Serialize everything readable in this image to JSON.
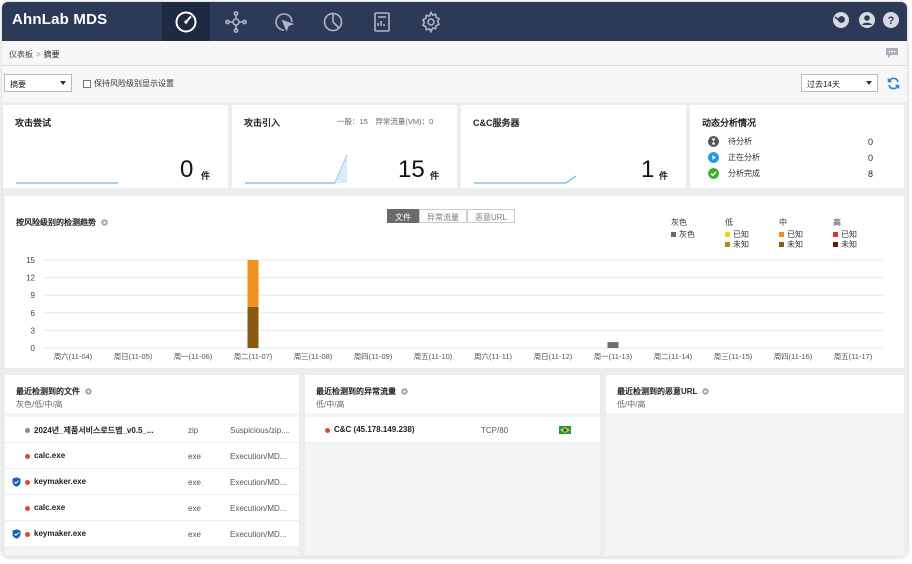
{
  "app": {
    "title": "AhnLab MDS"
  },
  "nav": {
    "items": [
      {
        "icon": "dashboard-gauge-icon",
        "active": true
      },
      {
        "icon": "network-nodes-icon",
        "active": false
      },
      {
        "icon": "cursor-click-icon",
        "active": false
      },
      {
        "icon": "pie-chart-icon",
        "active": false
      },
      {
        "icon": "report-document-icon",
        "active": false
      },
      {
        "icon": "gear-icon",
        "active": false
      }
    ],
    "right": [
      "notification-icon",
      "user-icon",
      "help-icon"
    ]
  },
  "breadcrumb": {
    "parent": "仪表板",
    "separator": ">",
    "current": "摘要"
  },
  "toolbar": {
    "view_select": "摘要",
    "keep_risk_label": "保持风险级别显示设置",
    "period_select": "过去14天"
  },
  "cards": {
    "attack_attempt": {
      "title": "攻击尝试",
      "value": "0",
      "unit": "件"
    },
    "attack_inflow": {
      "title": "攻击引入",
      "sub": "一般：15　异常流量(VM)：0",
      "value": "15",
      "unit": "件"
    },
    "cnc": {
      "title": "C&C服务器",
      "value": "1",
      "unit": "件"
    },
    "dynamic": {
      "title": "动态分析情况",
      "rows": [
        {
          "label": "待分析",
          "value": "0",
          "color": "#555555"
        },
        {
          "label": "正在分析",
          "value": "0",
          "color": "#1e9be6"
        },
        {
          "label": "分析完成",
          "value": "8",
          "color": "#3fae2a"
        }
      ]
    }
  },
  "trend": {
    "title": "按风险级别的检测趋势",
    "tabs": [
      {
        "label": "文件",
        "active": true
      },
      {
        "label": "异常流量",
        "active": false
      },
      {
        "label": "恶意URL",
        "active": false
      }
    ],
    "legend": [
      {
        "header": "灰色",
        "items": [
          {
            "label": "灰色",
            "color": "#6b6b6b"
          }
        ]
      },
      {
        "header": "低",
        "items": [
          {
            "label": "已知",
            "color": "#f2d024"
          },
          {
            "label": "未知",
            "color": "#a79312"
          }
        ]
      },
      {
        "header": "中",
        "items": [
          {
            "label": "已知",
            "color": "#f2901e"
          },
          {
            "label": "未知",
            "color": "#8b5a12"
          }
        ]
      },
      {
        "header": "高",
        "items": [
          {
            "label": "已知",
            "color": "#d9342b"
          },
          {
            "label": "未知",
            "color": "#6e1212"
          }
        ]
      }
    ]
  },
  "chart_data": {
    "type": "bar",
    "stacked": true,
    "categories": [
      "周六(11-04)",
      "周日(11-05)",
      "周一(11-06)",
      "周二(11-07)",
      "周三(11-08)",
      "周四(11-09)",
      "周五(11-10)",
      "周六(11-11)",
      "周日(11-12)",
      "周一(11-13)",
      "周二(11-14)",
      "周三(11-15)",
      "周四(11-16)",
      "周五(11-17)"
    ],
    "yticks": [
      "0",
      "3",
      "6",
      "9",
      "12",
      "15"
    ],
    "ylim": [
      0,
      15
    ],
    "grid": true,
    "legend_position": "top-right",
    "series": [
      {
        "name": "灰色",
        "color": "#6b6b6b",
        "values": [
          0,
          0,
          0,
          0,
          0,
          0,
          0,
          0,
          0,
          1,
          0,
          0,
          0,
          0
        ]
      },
      {
        "name": "中 未知",
        "color": "#8b5a12",
        "values": [
          0,
          0,
          0,
          7,
          0,
          0,
          0,
          0,
          0,
          0,
          0,
          0,
          0,
          0
        ]
      },
      {
        "name": "中 已知",
        "color": "#f2901e",
        "values": [
          0,
          0,
          0,
          8,
          0,
          0,
          0,
          0,
          0,
          0,
          0,
          0,
          0,
          0
        ]
      }
    ]
  },
  "recent_files": {
    "title": "最近检测到的文件",
    "sub": "灰色/低/中/高",
    "rows": [
      {
        "name": "2024년_제품서비스로드맵_v0.5_...",
        "ext": "zip",
        "detect": "Suspicious/zip....",
        "dot": "#8a8a8a",
        "shield": false
      },
      {
        "name": "calc.exe",
        "ext": "exe",
        "detect": "Execution/MD...",
        "dot": "#e0482c",
        "shield": false
      },
      {
        "name": "keymaker.exe",
        "ext": "exe",
        "detect": "Execution/MD...",
        "dot": "#e0482c",
        "shield": true
      },
      {
        "name": "calc.exe",
        "ext": "exe",
        "detect": "Execution/MD...",
        "dot": "#e0482c",
        "shield": false
      },
      {
        "name": "keymaker.exe",
        "ext": "exe",
        "detect": "Execution/MD...",
        "dot": "#e0482c",
        "shield": true
      }
    ]
  },
  "recent_traffic": {
    "title": "最近检测到的异常流量",
    "sub": "低/中/高",
    "rows": [
      {
        "name": "C&C (45.178.149.238)",
        "proto": "TCP/80",
        "flag": "brazil-flag-icon",
        "dot": "#e0482c"
      }
    ]
  },
  "recent_urls": {
    "title": "最近检测到的恶意URL",
    "sub": "低/中/高"
  }
}
